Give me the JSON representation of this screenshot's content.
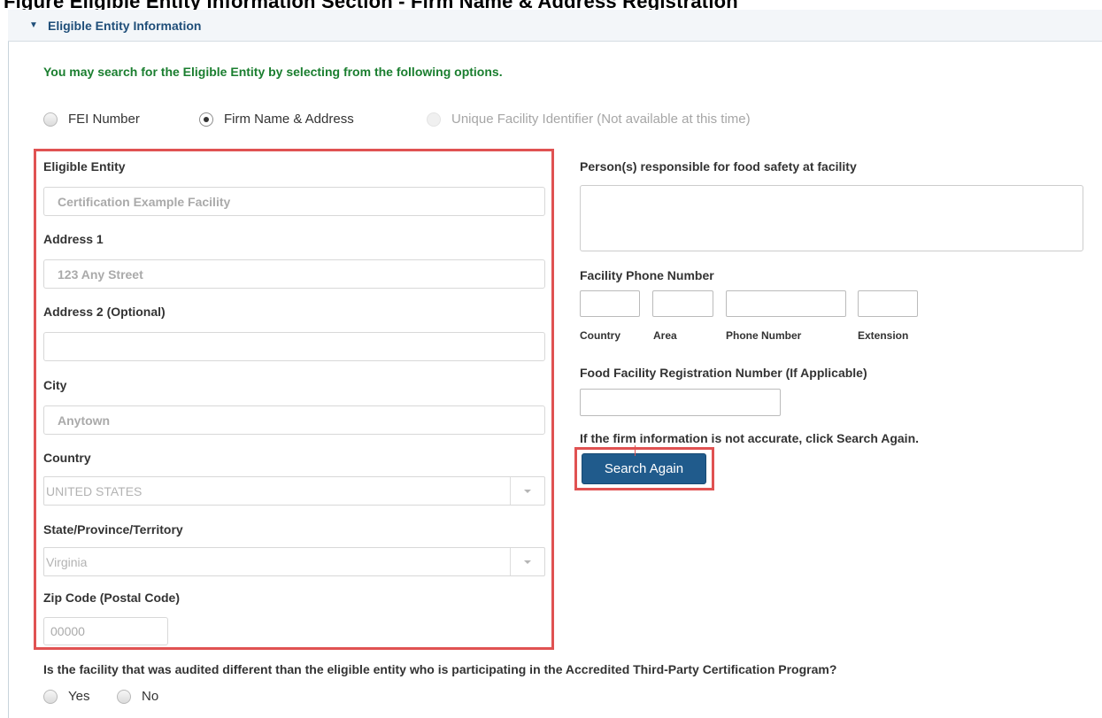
{
  "page_heading": "Figure Eligible Entity Information Section - Firm Name & Address Registration",
  "section": {
    "title": "Eligible Entity Information",
    "intro": "You may search for the Eligible Entity by selecting from the following options."
  },
  "search_options": [
    {
      "label": "FEI Number",
      "state": "unchecked"
    },
    {
      "label": "Firm Name & Address",
      "state": "checked"
    },
    {
      "label": "Unique Facility Identifier (Not available at this time)",
      "state": "disabled"
    }
  ],
  "left_form": {
    "eligible_entity": {
      "label": "Eligible Entity",
      "value": "Certification Example Facility"
    },
    "address1": {
      "label": "Address 1",
      "value": "123 Any Street"
    },
    "address2": {
      "label": "Address 2 (Optional)",
      "value": ""
    },
    "city": {
      "label": "City",
      "value": "Anytown"
    },
    "country": {
      "label": "Country",
      "value": "UNITED STATES"
    },
    "state": {
      "label": "State/Province/Territory",
      "value": "Virginia"
    },
    "zip": {
      "label": "Zip Code (Postal Code)",
      "value": "00000"
    }
  },
  "right_form": {
    "food_safety": {
      "label": "Person(s) responsible for food safety at facility",
      "value": ""
    },
    "phone": {
      "label": "Facility Phone Number",
      "country": "Country",
      "area": "Area",
      "number": "Phone Number",
      "extension": "Extension"
    },
    "registration": {
      "label": "Food Facility Registration Number (If Applicable)",
      "value": ""
    },
    "accuracy_note": "If the firm information is not accurate, click Search Again.",
    "search_again_button": "Search Again"
  },
  "audited_question": {
    "text": "Is the facility that was audited different than the eligible entity who is participating in the Accredited Third-Party Certification Program?",
    "options": [
      "Yes",
      "No"
    ]
  },
  "colors": {
    "header_text": "#1f4e79",
    "intro_text": "#1a7e2f",
    "highlight": "#e05252",
    "button": "#205b8c"
  }
}
